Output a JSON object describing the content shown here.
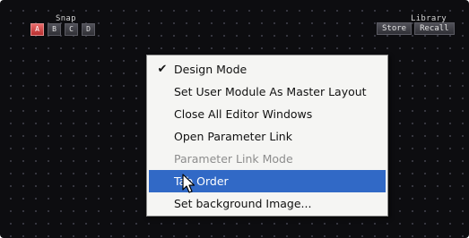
{
  "snap": {
    "label": "Snap",
    "buttons": [
      "A",
      "B",
      "C",
      "D"
    ],
    "active": "A"
  },
  "library": {
    "label": "Library",
    "store_label": "Store",
    "recall_label": "Recall"
  },
  "context_menu": {
    "items": [
      {
        "label": "Design Mode",
        "checked": true,
        "enabled": true,
        "highlighted": false
      },
      {
        "label": "Set User Module As Master Layout",
        "checked": false,
        "enabled": true,
        "highlighted": false
      },
      {
        "label": "Close All Editor Windows",
        "checked": false,
        "enabled": true,
        "highlighted": false
      },
      {
        "label": "Open Parameter Link",
        "checked": false,
        "enabled": true,
        "highlighted": false
      },
      {
        "label": "Parameter Link Mode",
        "checked": false,
        "enabled": false,
        "highlighted": false
      },
      {
        "label": "Tab Order",
        "checked": false,
        "enabled": true,
        "highlighted": true
      },
      {
        "label": "Set background Image...",
        "checked": false,
        "enabled": true,
        "highlighted": false
      }
    ]
  },
  "colors": {
    "canvas_background": "#0d0d10",
    "menu_background": "#f5f5f3",
    "highlight": "#3169c6",
    "active_snap": "#cc4444"
  },
  "icons": {
    "check": "check-icon",
    "cursor": "mouse-cursor-icon"
  }
}
